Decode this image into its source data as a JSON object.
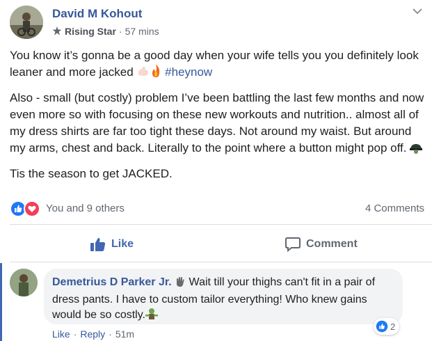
{
  "post": {
    "author": "David M Kohout",
    "badge": "Rising Star",
    "time": "57 mins",
    "paragraphs": {
      "p1_text": "You know it’s gonna be a good day when your wife tells you you definitely look leaner and more jacked ",
      "p1_hashtag": "#heynow",
      "p2_text": "Also - small (but costly) problem I’ve been battling the last few months and now even more so with focusing on these new workouts and nutrition.. almost all of my dress shirts are far too tight these days. Not around my waist. But around my arms, chest and back. Literally to the point where a button might pop off. ",
      "p3_text": "Tis the season to get JACKED."
    },
    "reactions_text": "You and 9 others",
    "comments_count": "4 Comments"
  },
  "actions": {
    "like_label": "Like",
    "comment_label": "Comment"
  },
  "comment": {
    "author": "Demetrius D Parker Jr.",
    "text_part": " Wait till your thighs can't fit in a pair of dress pants. I have to custom tailor everything! Who knew gains would be so costly.",
    "reaction_count": "2",
    "like_label": "Like",
    "reply_label": "Reply",
    "time": "51m"
  },
  "icons": {
    "badge_icon": "star-badge-icon",
    "reaction_like": "like-reaction-icon",
    "reaction_love": "love-reaction-icon",
    "like_action": "thumbs-up-icon",
    "comment_action": "speech-bubble-icon",
    "chevron": "chevron-down-icon"
  },
  "colors": {
    "link_blue": "#365899",
    "action_blue": "#4267b2",
    "love_red": "#f33e58",
    "muted": "#606770"
  }
}
